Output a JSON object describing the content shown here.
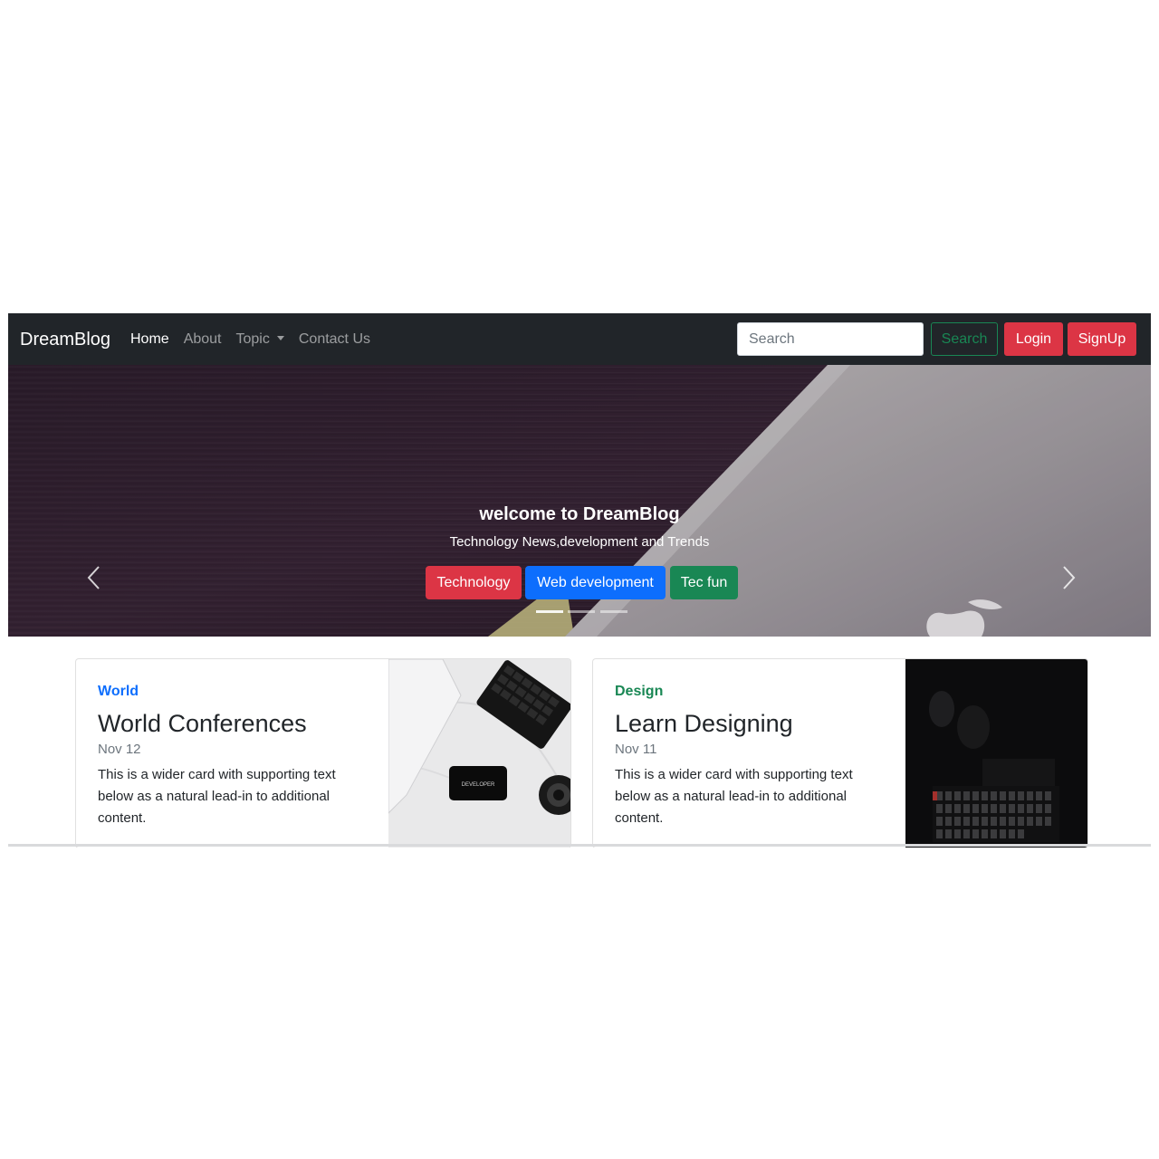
{
  "navbar": {
    "brand": "DreamBlog",
    "links": [
      {
        "label": "Home",
        "active": true
      },
      {
        "label": "About",
        "active": false
      },
      {
        "label": "Topic",
        "active": false,
        "dropdown": true
      },
      {
        "label": "Contact Us",
        "active": false
      }
    ],
    "search_placeholder": "Search",
    "search_button": "Search",
    "login_button": "Login",
    "signup_button": "SignUp"
  },
  "hero": {
    "title": "welcome to DreamBlog",
    "subtitle": "Technology News,development and Trends",
    "buttons": [
      {
        "label": "Technology",
        "color": "#dc3545"
      },
      {
        "label": "Web development",
        "color": "#0d6efd"
      },
      {
        "label": "Tec fun",
        "color": "#198754"
      }
    ],
    "slide_count": 3,
    "active_slide": 1
  },
  "cards": [
    {
      "category": "World",
      "category_color": "#0d6efd",
      "title": "World Conferences",
      "date": "Nov 12",
      "text": "This is a wider card with supporting text below as a natural lead-in to additional content.",
      "image_label": "DEVELOPER"
    },
    {
      "category": "Design",
      "category_color": "#198754",
      "title": "Learn Designing",
      "date": "Nov 11",
      "text": "This is a wider card with supporting text below as a natural lead-in to additional content."
    }
  ],
  "colors": {
    "navbar_bg": "#212529",
    "danger": "#dc3545",
    "primary": "#0d6efd",
    "success": "#198754"
  }
}
